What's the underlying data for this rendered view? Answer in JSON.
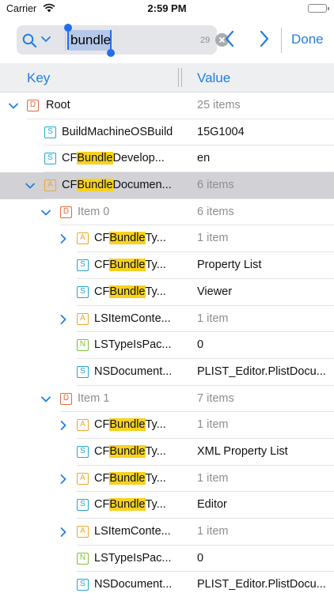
{
  "status_bar": {
    "carrier": "Carrier",
    "time": "2:59 PM"
  },
  "search": {
    "query": "bundle",
    "match_count": "29",
    "done_label": "Done"
  },
  "columns": {
    "key": "Key",
    "value": "Value"
  },
  "colors": {
    "accent": "#1f7fe6",
    "highlight": "#f7d21e",
    "selected_row": "#d1d1d6"
  },
  "rows": [
    {
      "level": 0,
      "disclosure": "expanded",
      "type": "D",
      "key": [
        "Root"
      ],
      "value": "25 items",
      "muted_value": true,
      "muted_key": false,
      "selected": false
    },
    {
      "level": 1,
      "disclosure": "none",
      "type": "S",
      "key": [
        "BuildMachineOSBuild"
      ],
      "value": "15G1004",
      "muted_value": false,
      "muted_key": false,
      "selected": false
    },
    {
      "level": 1,
      "disclosure": "none",
      "type": "S",
      "key": [
        "CF",
        "Bundle",
        "Develop..."
      ],
      "value": "en",
      "muted_value": false,
      "muted_key": false,
      "selected": false
    },
    {
      "level": 1,
      "disclosure": "expanded",
      "type": "A",
      "key": [
        "CF",
        "Bundle",
        "Documen..."
      ],
      "value": "6 items",
      "muted_value": true,
      "muted_key": false,
      "selected": true
    },
    {
      "level": 2,
      "disclosure": "expanded",
      "type": "D",
      "key": [
        "Item 0"
      ],
      "value": "6 items",
      "muted_value": true,
      "muted_key": true,
      "selected": false
    },
    {
      "level": 3,
      "disclosure": "collapsed",
      "type": "A",
      "key": [
        "CF",
        "Bundle",
        "Ty..."
      ],
      "value": "1 item",
      "muted_value": true,
      "muted_key": false,
      "selected": false
    },
    {
      "level": 3,
      "disclosure": "none",
      "type": "S",
      "key": [
        "CF",
        "Bundle",
        "Ty..."
      ],
      "value": "Property List",
      "muted_value": false,
      "muted_key": false,
      "selected": false
    },
    {
      "level": 3,
      "disclosure": "none",
      "type": "S",
      "key": [
        "CF",
        "Bundle",
        "Ty..."
      ],
      "value": "Viewer",
      "muted_value": false,
      "muted_key": false,
      "selected": false
    },
    {
      "level": 3,
      "disclosure": "collapsed",
      "type": "A",
      "key": [
        "LSItemConte..."
      ],
      "value": "1 item",
      "muted_value": true,
      "muted_key": false,
      "selected": false
    },
    {
      "level": 3,
      "disclosure": "none",
      "type": "N",
      "key": [
        "LSTypeIsPac..."
      ],
      "value": "0",
      "muted_value": false,
      "muted_key": false,
      "selected": false
    },
    {
      "level": 3,
      "disclosure": "none",
      "type": "S",
      "key": [
        "NSDocument..."
      ],
      "value": "PLIST_Editor.PlistDocu...",
      "muted_value": false,
      "muted_key": false,
      "selected": false
    },
    {
      "level": 2,
      "disclosure": "expanded",
      "type": "D",
      "key": [
        "Item 1"
      ],
      "value": "7 items",
      "muted_value": true,
      "muted_key": true,
      "selected": false
    },
    {
      "level": 3,
      "disclosure": "collapsed",
      "type": "A",
      "key": [
        "CF",
        "Bundle",
        "Ty..."
      ],
      "value": "1 item",
      "muted_value": true,
      "muted_key": false,
      "selected": false
    },
    {
      "level": 3,
      "disclosure": "none",
      "type": "S",
      "key": [
        "CF",
        "Bundle",
        "Ty..."
      ],
      "value": "XML Property List",
      "muted_value": false,
      "muted_key": false,
      "selected": false
    },
    {
      "level": 3,
      "disclosure": "collapsed",
      "type": "A",
      "key": [
        "CF",
        "Bundle",
        "Ty..."
      ],
      "value": "1 item",
      "muted_value": true,
      "muted_key": false,
      "selected": false
    },
    {
      "level": 3,
      "disclosure": "none",
      "type": "S",
      "key": [
        "CF",
        "Bundle",
        "Ty..."
      ],
      "value": "Editor",
      "muted_value": false,
      "muted_key": false,
      "selected": false
    },
    {
      "level": 3,
      "disclosure": "collapsed",
      "type": "A",
      "key": [
        "LSItemConte..."
      ],
      "value": "1 item",
      "muted_value": true,
      "muted_key": false,
      "selected": false
    },
    {
      "level": 3,
      "disclosure": "none",
      "type": "N",
      "key": [
        "LSTypeIsPac..."
      ],
      "value": "0",
      "muted_value": false,
      "muted_key": false,
      "selected": false
    },
    {
      "level": 3,
      "disclosure": "none",
      "type": "S",
      "key": [
        "NSDocument..."
      ],
      "value": "PLIST_Editor.PlistDocu...",
      "muted_value": false,
      "muted_key": false,
      "selected": false
    }
  ]
}
